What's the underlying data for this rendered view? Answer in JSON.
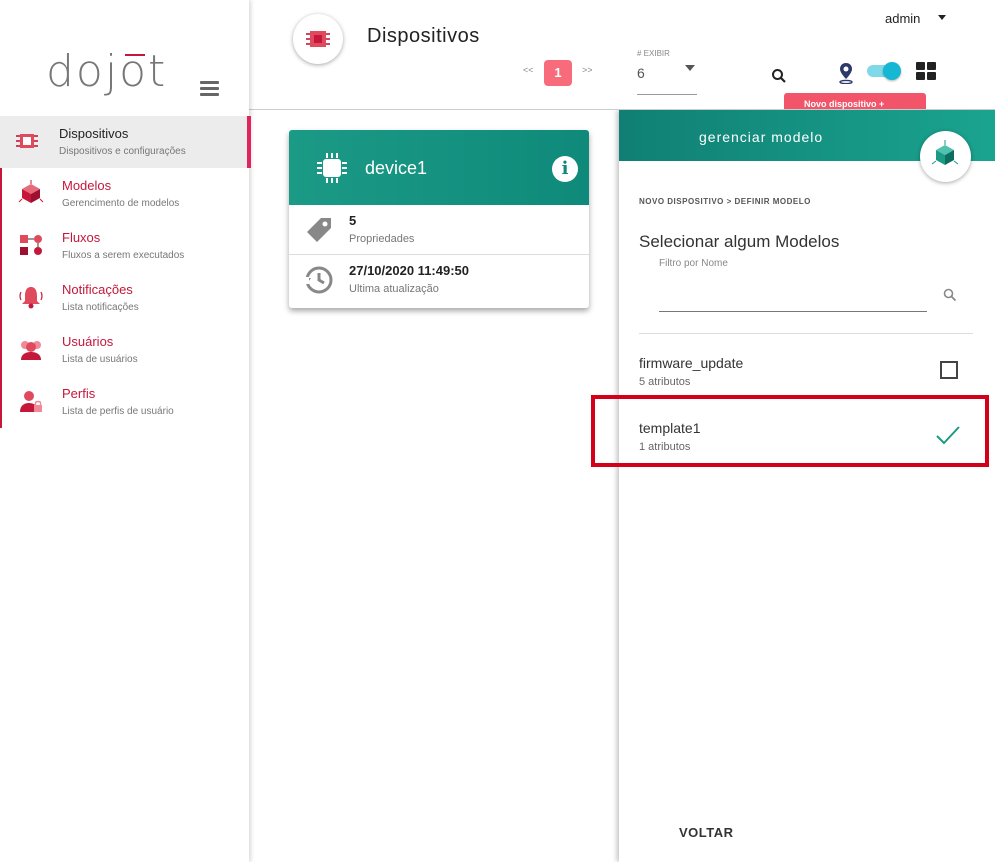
{
  "logo": {
    "text": "dojot"
  },
  "sidebar": {
    "items": [
      {
        "title": "Dispositivos",
        "subtitle": "Dispositivos e configurações",
        "active": true
      },
      {
        "title": "Modelos",
        "subtitle": "Gerencimento de modelos"
      },
      {
        "title": "Fluxos",
        "subtitle": "Fluxos a serem executados"
      },
      {
        "title": "Notificações",
        "subtitle": "Lista notificações"
      },
      {
        "title": "Usuários",
        "subtitle": "Lista de usuários"
      },
      {
        "title": "Perfis",
        "subtitle": "Lista de perfis de usuário"
      }
    ]
  },
  "header": {
    "title": "Dispositivos",
    "pager": {
      "prev": "<<",
      "page": "1",
      "next": ">>"
    },
    "show": {
      "label": "# EXIBIR",
      "value": "6"
    },
    "user": "admin",
    "new_device_label": "Novo dispositivo +"
  },
  "device_card": {
    "name": "device1",
    "info": "i",
    "properties_count": "5",
    "properties_label": "Propriedades",
    "updated_at": "27/10/2020 11:49:50",
    "updated_label": "Ultima atualização"
  },
  "panel": {
    "title": "gerenciar modelo",
    "breadcrumb": "NOVO DISPOSITIVO > DEFINIR MODELO",
    "select_title": "Selecionar algum Modelos",
    "filter_label": "Filtro por Nome",
    "filter_value": "",
    "templates": [
      {
        "name": "firmware_update",
        "attrs": "5 atributos",
        "selected": false
      },
      {
        "name": "template1",
        "attrs": "1 atributos",
        "selected": true
      }
    ],
    "back_label": "VOLTAR"
  },
  "colors": {
    "brand_red": "#c4173a",
    "accent_pink": "#f76b7b",
    "teal": "#1b9a86",
    "toggle_cyan": "#15b7d3",
    "highlight": "#d4001a"
  }
}
